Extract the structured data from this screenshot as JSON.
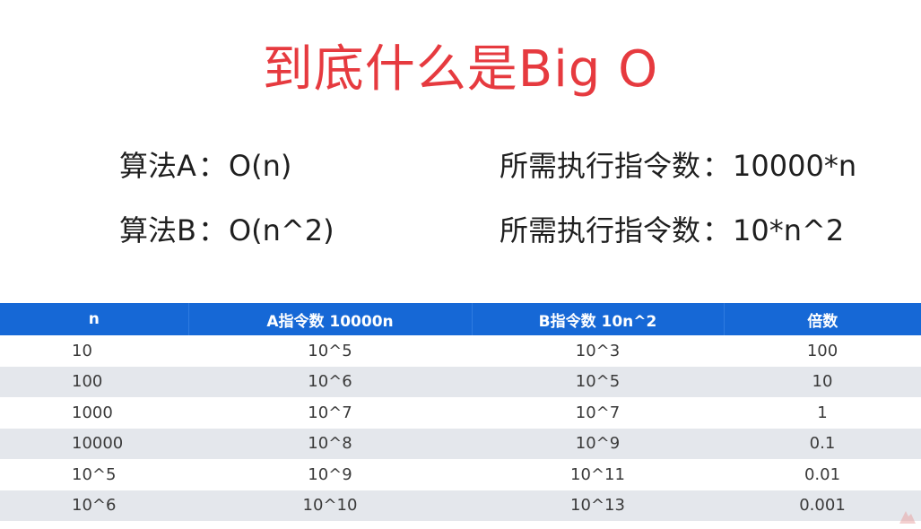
{
  "title": "到底什么是Big O",
  "algorithms": [
    {
      "name": "算法A",
      "colon": "：",
      "complexity": "O(n)",
      "instr_label": "所需执行指令数",
      "instr_value": "10000*n"
    },
    {
      "name": "算法B",
      "colon": "：",
      "complexity": "O(n^2)",
      "instr_label": "所需执行指令数",
      "instr_value": "10*n^2"
    }
  ],
  "table": {
    "headers": [
      "n",
      "A指令数 10000n",
      "B指令数 10n^2",
      "倍数"
    ],
    "rows": [
      [
        "10",
        "10^5",
        "10^3",
        "100"
      ],
      [
        "100",
        "10^6",
        "10^5",
        "10"
      ],
      [
        "1000",
        "10^7",
        "10^7",
        "1"
      ],
      [
        "10000",
        "10^8",
        "10^9",
        "0.1"
      ],
      [
        "10^5",
        "10^9",
        "10^11",
        "0.01"
      ],
      [
        "10^6",
        "10^10",
        "10^13",
        "0.001"
      ]
    ]
  },
  "colors": {
    "title": "#e63a3f",
    "header_bg": "#1668d6",
    "stripe": "#e4e7ec"
  }
}
